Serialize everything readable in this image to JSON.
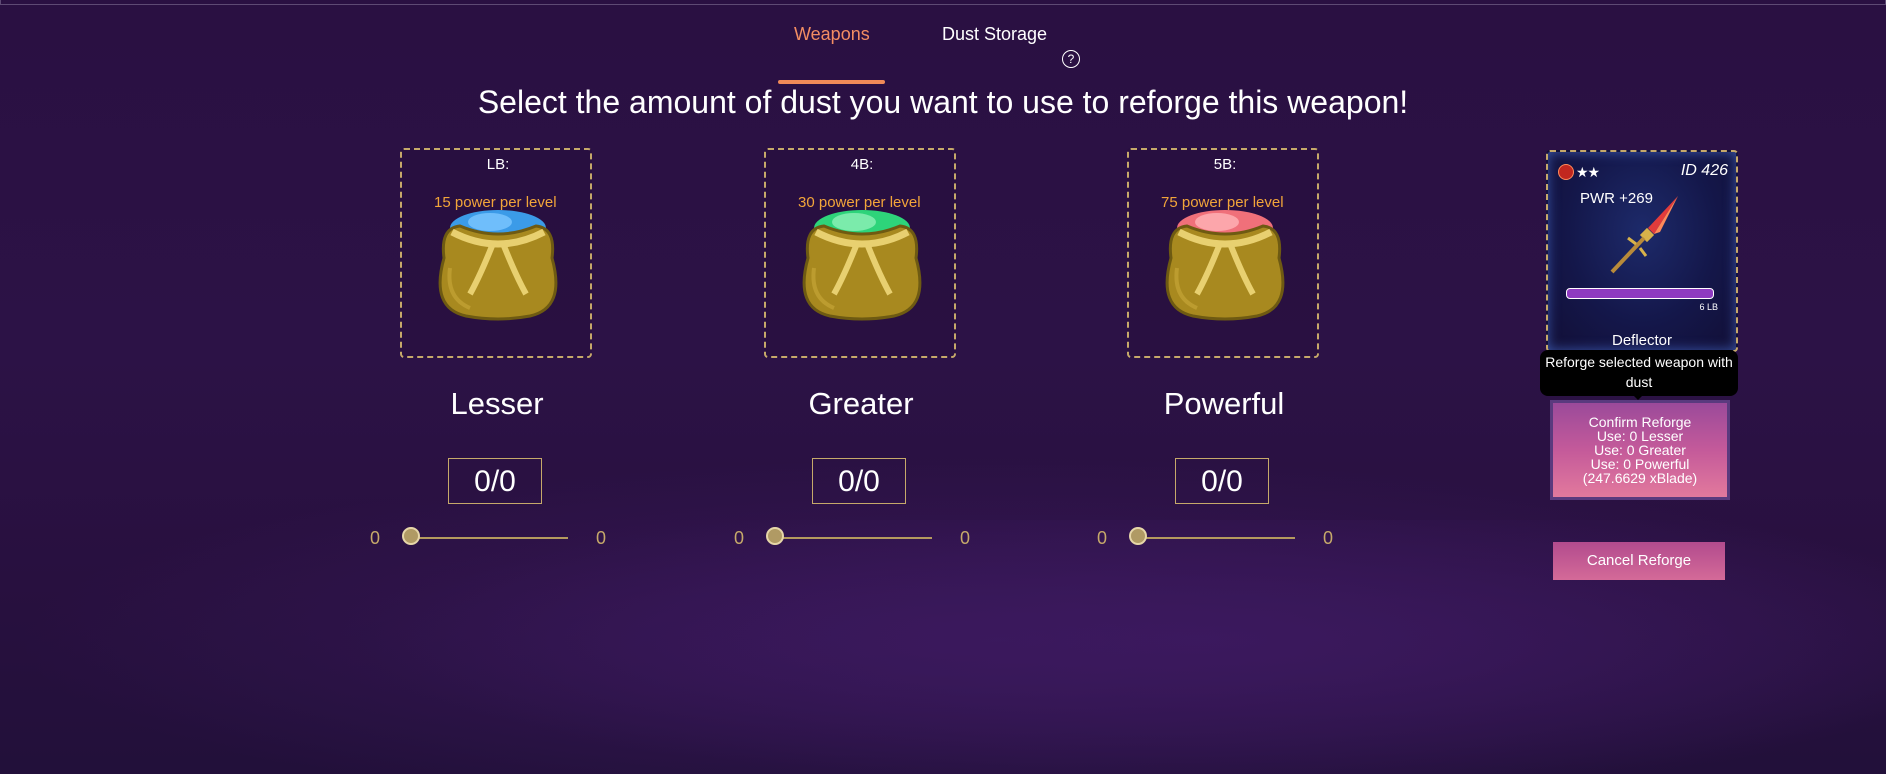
{
  "tabs": {
    "weapons": "Weapons",
    "dust_storage": "Dust Storage",
    "help_glyph": "?"
  },
  "headline": "Select the amount of dust you want to use to reforge this weapon!",
  "dust": [
    {
      "prefix": "LB: ",
      "power_text": "15 power per level",
      "name": "Lesser",
      "amount": "0/0",
      "slider_min": "0",
      "slider_max": "0",
      "dust_color": "#3b9be8"
    },
    {
      "prefix": "4B: ",
      "power_text": "30 power per level",
      "name": "Greater",
      "amount": "0/0",
      "slider_min": "0",
      "slider_max": "0",
      "dust_color": "#2ed47a"
    },
    {
      "prefix": "5B: ",
      "power_text": "75 power per level",
      "name": "Powerful",
      "amount": "0/0",
      "slider_min": "0",
      "slider_max": "0",
      "dust_color": "#f0707a"
    }
  ],
  "weapon": {
    "stars": "★★",
    "id": "ID 426",
    "power": "PWR +269",
    "lb_label": "6 LB",
    "name": "Deflector",
    "element_icon": "fire-element-icon"
  },
  "tooltip": "Reforge selected weapon with dust",
  "confirm": {
    "line1": "Confirm Reforge",
    "line2": "Use: 0 Lesser",
    "line3": "Use: 0 Greater",
    "line4": "Use: 0 Powerful",
    "line5": "(247.6629 xBlade)"
  },
  "cancel": "Cancel Reforge",
  "colors": {
    "accent_tab": "#f38d63",
    "power_text": "#f2a53a",
    "gold_border": "#c6a96a",
    "button_pink": "#d46a98"
  }
}
